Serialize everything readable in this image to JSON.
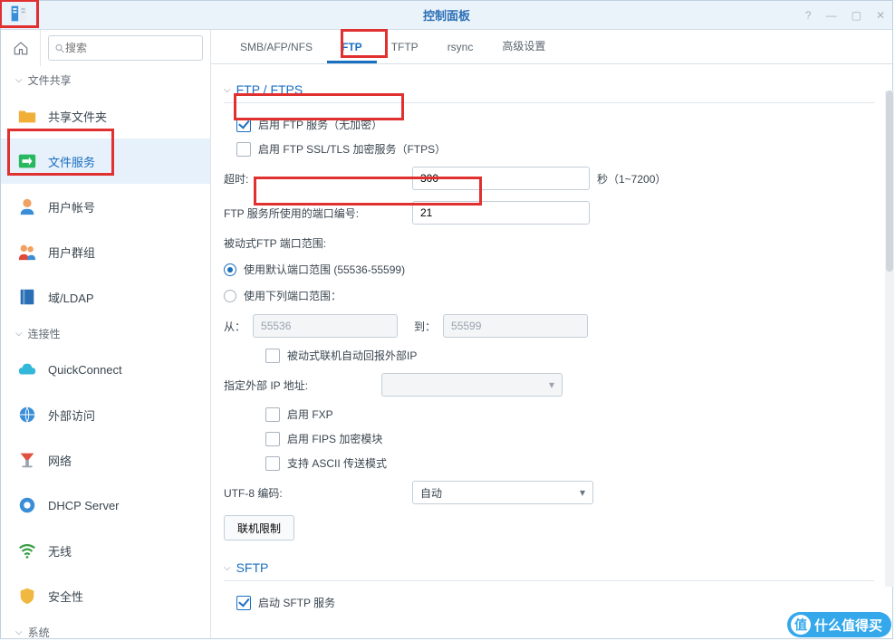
{
  "window": {
    "title": "控制面板"
  },
  "search": {
    "placeholder": "搜索"
  },
  "sidebar": {
    "section_share": "文件共享",
    "section_connect": "连接性",
    "section_system": "系统",
    "items": {
      "shared_folder": "共享文件夹",
      "file_service": "文件服务",
      "user_account": "用户帐号",
      "user_group": "用户群组",
      "ldap": "域/LDAP",
      "quickconnect": "QuickConnect",
      "external_access": "外部访问",
      "network": "网络",
      "dhcp": "DHCP Server",
      "wireless": "无线",
      "security": "安全性"
    }
  },
  "tabs": {
    "smb": "SMB/AFP/NFS",
    "ftp": "FTP",
    "tftp": "TFTP",
    "rsync": "rsync",
    "advanced": "高级设置"
  },
  "ftp": {
    "section": "FTP / FTPS",
    "enable_plain": "启用 FTP 服务（无加密）",
    "enable_ftps": "启用 FTP SSL/TLS 加密服务（FTPS）",
    "timeout_label": "超时:",
    "timeout_value": "300",
    "timeout_unit": "秒（1~7200）",
    "port_label": "FTP 服务所使用的端口编号:",
    "port_value": "21",
    "passive_range_label": "被动式FTP 端口范围:",
    "range_default": "使用默认端口范围 (55536-55599)",
    "range_custom": "使用下列端口范围：",
    "range_from": "从：",
    "range_from_value": "55536",
    "range_to": "到：",
    "range_to_value": "55599",
    "passive_external": "被动式联机自动回报外部IP",
    "external_ip_label": "指定外部 IP 地址:",
    "enable_fxp": "启用 FXP",
    "enable_fips": "启用 FIPS 加密模块",
    "enable_ascii": "支持 ASCII 传送模式",
    "utf8_label": "UTF-8 编码:",
    "utf8_value": "自动",
    "conn_limit": "联机限制"
  },
  "sftp": {
    "section": "SFTP",
    "enable": "启动 SFTP 服务"
  },
  "watermark": "什么值得买"
}
